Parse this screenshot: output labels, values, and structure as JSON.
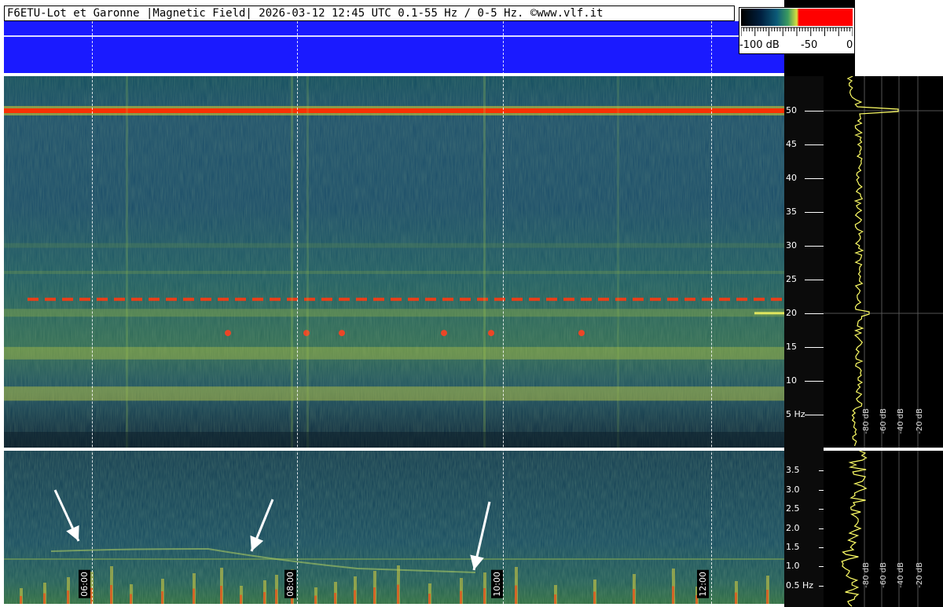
{
  "header": {
    "title": "F6ETU-Lot et Garonne |Magnetic Field| 2026-03-12 12:45 UTC 0.1-55 Hz / 0-5 Hz. ©www.vlf.it"
  },
  "colorbar": {
    "min_label": "-100 dB",
    "mid_label": "-50",
    "max_label": "0"
  },
  "main_axis": {
    "labels": [
      "50",
      "45",
      "40",
      "35",
      "30",
      "25",
      "20",
      "15",
      "10",
      "5 Hz"
    ]
  },
  "low_axis": {
    "labels": [
      "3.5",
      "3.0",
      "2.5",
      "2.0",
      "1.5",
      "1.0",
      "0.5 Hz"
    ]
  },
  "time_axis": {
    "labels": [
      "06:00",
      "08:00",
      "10:00",
      "12:00"
    ]
  },
  "profile_db_labels": [
    "-80 dB",
    "-60 dB",
    "-40 dB",
    "-20 dB"
  ],
  "colors": {
    "banner_blue": "#1a1aff",
    "power_line": "#ff2a00",
    "spectrogram_bg": "#0e3a55",
    "trace_yellow": "#ffff66"
  }
}
